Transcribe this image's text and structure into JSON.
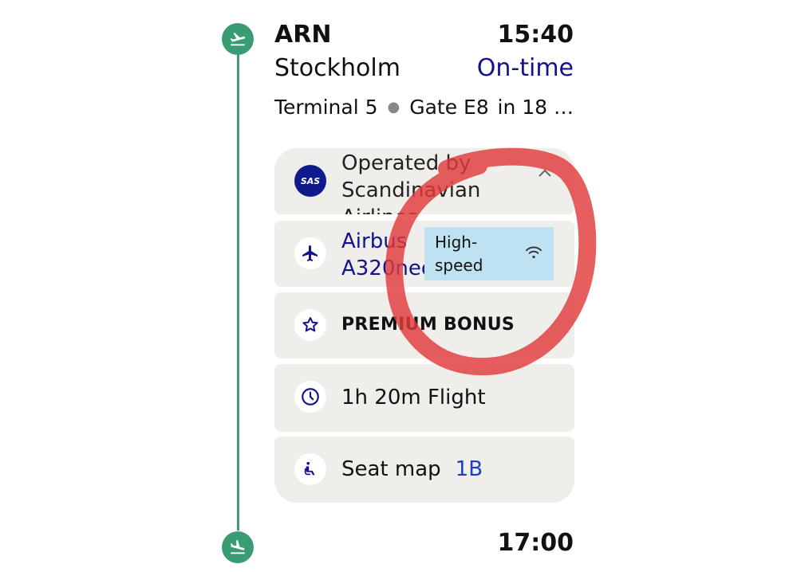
{
  "departure": {
    "code": "ARN",
    "time": "15:40",
    "city": "Stockholm",
    "status": "On-time",
    "terminal": "Terminal 5",
    "gate": "Gate E8",
    "countdown": "in 18 …"
  },
  "cards": {
    "operator": {
      "logo_text": "SAS",
      "label": "Operated by Scandinavian Airlines"
    },
    "aircraft": {
      "label": "Airbus A320neo",
      "wifi_label": "High-speed"
    },
    "bonus": {
      "label": "PREMIUM BONUS"
    },
    "duration": {
      "label": "1h 20m Flight"
    },
    "seat": {
      "label": "Seat map",
      "value": "1B"
    }
  },
  "arrival": {
    "time": "17:00"
  },
  "icons": {
    "departure": "plane-takeoff-icon",
    "arrival": "plane-landing-icon",
    "aircraft": "airplane-icon",
    "bonus": "star-icon",
    "duration": "clock-icon",
    "seat": "seat-icon",
    "wifi": "wifi-icon",
    "chevron": "chevron-up-icon"
  },
  "colors": {
    "timeline": "#3a9c72",
    "accent": "#12128c",
    "seat_value": "#1b3fbf",
    "card_bg": "#efeeeb",
    "wifi_bg": "#bfe2f2",
    "annotation": "#e23a3a"
  }
}
